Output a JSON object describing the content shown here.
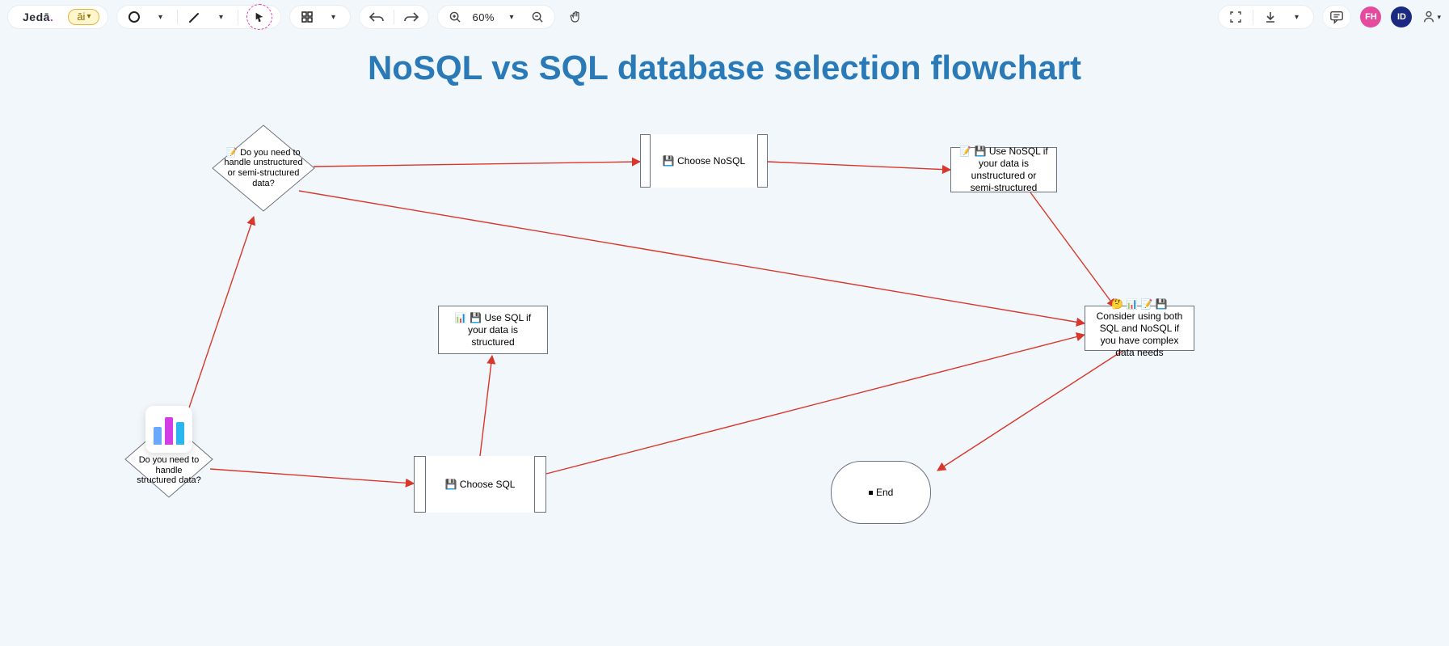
{
  "app": {
    "logo": "Jedā",
    "ai_label": "āi"
  },
  "toolbar": {
    "zoom_percent": "60%",
    "avatars": [
      "FH",
      "ID"
    ]
  },
  "diagram": {
    "title": "NoSQL vs SQL database selection flowchart",
    "nodes": {
      "d1": "📝 Do you need to handle unstructured or semi-structured data?",
      "d2": "Do you need to handle structured data?",
      "p_nosql": "💾 Choose NoSQL",
      "p_sql": "💾 Choose SQL",
      "r_nosql": "📝 💾 Use NoSQL if your data is unstructured or semi-structured",
      "r_sql": "📊 💾 Use SQL if your data is structured",
      "both": "🤔 📊 📝 💾 Consider using both SQL and NoSQL if you have complex data needs",
      "end": "⏹ End"
    },
    "edges": [
      [
        "d1",
        "p_nosql"
      ],
      [
        "p_nosql",
        "r_nosql"
      ],
      [
        "r_nosql",
        "both"
      ],
      [
        "d1",
        "both"
      ],
      [
        "d2",
        "d1"
      ],
      [
        "d2",
        "p_sql"
      ],
      [
        "p_sql",
        "r_sql"
      ],
      [
        "p_sql",
        "both"
      ],
      [
        "both",
        "end"
      ]
    ]
  }
}
